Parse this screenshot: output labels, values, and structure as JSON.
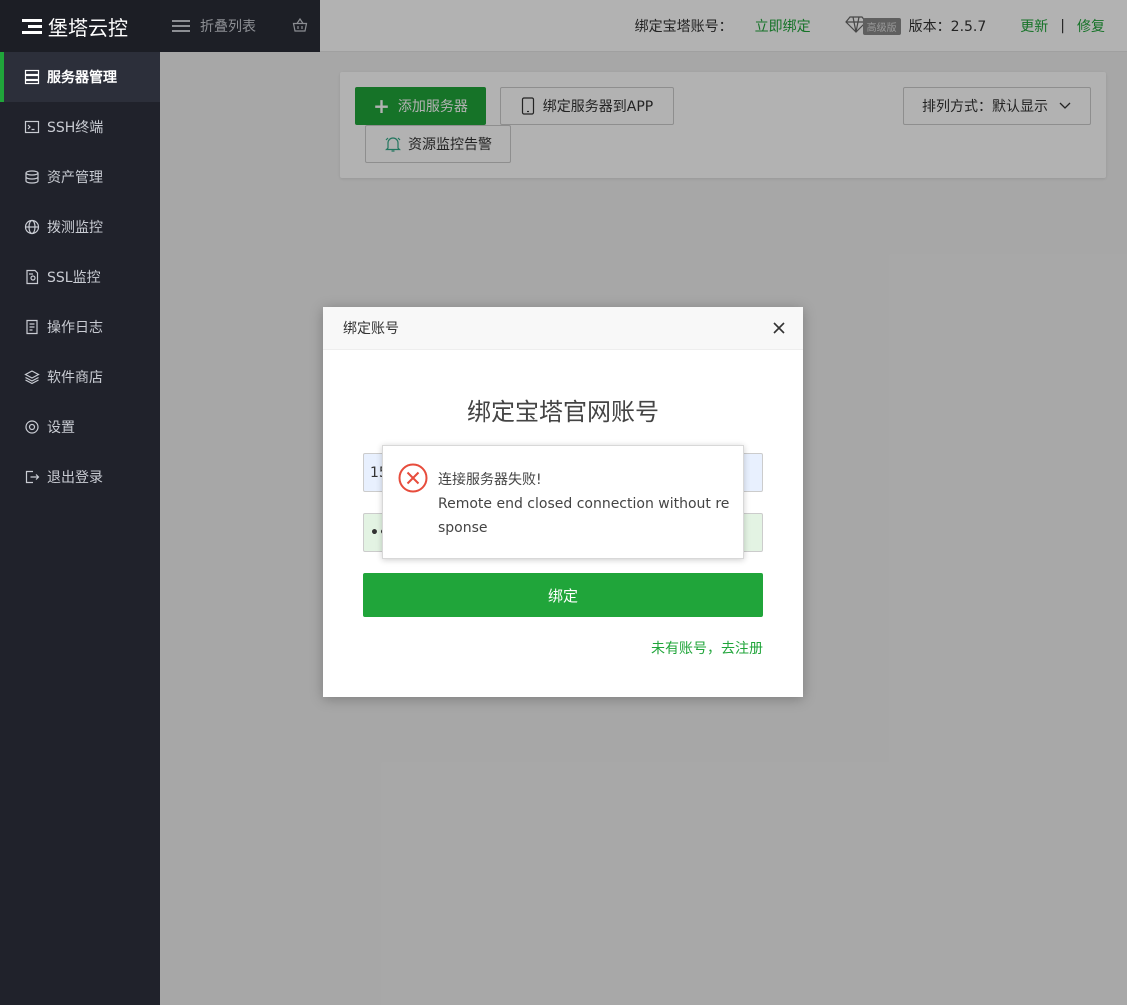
{
  "sidebar": {
    "logo": "堡塔云控",
    "items": [
      {
        "label": "服务器管理",
        "icon": "server-icon"
      },
      {
        "label": "SSH终端",
        "icon": "terminal-icon"
      },
      {
        "label": "资产管理",
        "icon": "database-icon"
      },
      {
        "label": "拨测监控",
        "icon": "globe-icon"
      },
      {
        "label": "SSL监控",
        "icon": "certificate-icon"
      },
      {
        "label": "操作日志",
        "icon": "log-icon"
      },
      {
        "label": "软件商店",
        "icon": "layers-icon"
      },
      {
        "label": "设置",
        "icon": "gear-icon"
      },
      {
        "label": "退出登录",
        "icon": "logout-icon"
      }
    ]
  },
  "topbar": {
    "collapse_label": "折叠列表",
    "account_label": "绑定宝塔账号：",
    "bind_now": "立即绑定",
    "badge": "高级版",
    "version": "版本：2.5.7",
    "update": "更新",
    "separator": "|",
    "repair": "修复"
  },
  "toolbar": {
    "add_server": "添加服务器",
    "bind_app": "绑定服务器到APP",
    "monitor_alert": "资源监控告警",
    "sort": "排列方式：默认显示"
  },
  "modal": {
    "header": "绑定账号",
    "title": "绑定宝塔官网账号",
    "field1_value": "15",
    "field2_value": "•••",
    "bind_button": "绑定",
    "register_link": "未有账号，去注册"
  },
  "toast": {
    "title": "连接服务器失败!",
    "detail": "Remote end closed connection without response"
  },
  "colors": {
    "accent": "#20a53a",
    "sidebar_bg": "#20222b",
    "error": "#e74c3c"
  }
}
